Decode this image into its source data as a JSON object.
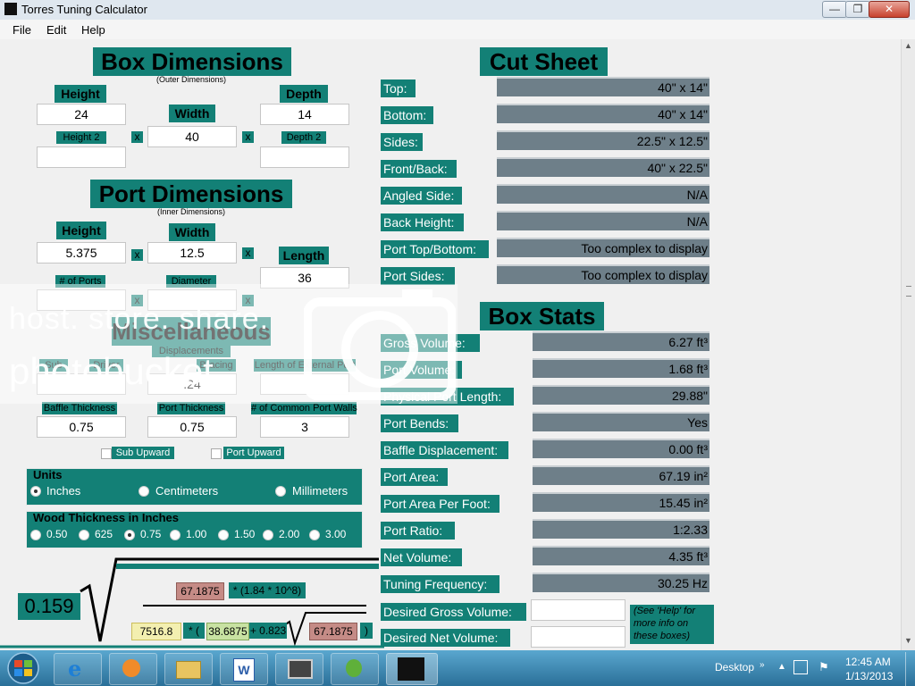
{
  "window": {
    "title": "Torres Tuning Calculator",
    "min": "—",
    "max": "❐",
    "close": "✕"
  },
  "menu": [
    "File",
    "Edit",
    "Help"
  ],
  "box_dimensions": {
    "title": "Box Dimensions",
    "subtitle": "(Outer Dimensions)",
    "height_label": "Height",
    "width_label": "Width",
    "depth_label": "Depth",
    "height": "24",
    "width": "40",
    "depth": "14",
    "height2_label": "Height 2",
    "depth2_label": "Depth 2",
    "height2": "",
    "depth2": ""
  },
  "port_dimensions": {
    "title": "Port Dimensions",
    "subtitle": "(Inner Dimensions)",
    "height_label": "Height",
    "width_label": "Width",
    "length_label": "Length",
    "height": "5.375",
    "width": "12.5",
    "length": "36",
    "ports_label": "# of Ports",
    "diameter_label": "Diameter",
    "ports": "",
    "diameter": ""
  },
  "misc": {
    "title": "Miscellaneous",
    "displacements_label": "Displacements",
    "sub_label": "Sub",
    "driver_label": "Driver",
    "bracing_label": "Bracing",
    "external_port_label": "Length of External Port",
    "sub": "",
    "driver": ".24",
    "bracing": "",
    "external_port": "",
    "baffle_label": "Baffle Thickness",
    "port_thickness_label": "Port Thickness",
    "common_walls_label": "# of Common Port Walls",
    "baffle": "0.75",
    "port_thickness": "0.75",
    "common_walls": "3",
    "sub_upward": "Sub Upward",
    "port_upward": "Port Upward"
  },
  "units": {
    "title": "Units",
    "options": [
      "Inches",
      "Centimeters",
      "Millimeters"
    ],
    "selected": "Inches"
  },
  "wood": {
    "title": "Wood Thickness in Inches",
    "options": [
      "0.50",
      "625",
      "0.75",
      "1.00",
      "1.50",
      "2.00",
      "3.00"
    ],
    "selected": "0.75"
  },
  "x_sign": "x",
  "formula": {
    "coef": "0.159",
    "area1": "67.1875",
    "factor": "* (1.84 * 10^8)",
    "v1": "7516.8",
    "op1": "* (",
    "v2": "38.6875",
    "op2": "+ 0.823",
    "area2": "67.1875",
    "close": ")"
  },
  "cut_sheet": {
    "title": "Cut Sheet",
    "rows": [
      {
        "label": "Top:",
        "value": "40\" x 14\""
      },
      {
        "label": "Bottom:",
        "value": "40\" x 14\""
      },
      {
        "label": "Sides:",
        "value": "22.5\" x 12.5\""
      },
      {
        "label": "Front/Back:",
        "value": "40\" x 22.5\""
      },
      {
        "label": "Angled Side:",
        "value": "N/A"
      },
      {
        "label": "Back Height:",
        "value": "N/A"
      },
      {
        "label": "Port Top/Bottom:",
        "value": "Too complex to display"
      },
      {
        "label": "Port Sides:",
        "value": "Too complex to display"
      }
    ]
  },
  "box_stats": {
    "title": "Box Stats",
    "rows": [
      {
        "label": "Gross Volume:",
        "value": "6.27 ft³"
      },
      {
        "label": "Port Volume:",
        "value": "1.68 ft³"
      },
      {
        "label": "Physical Port Length:",
        "value": "29.88\""
      },
      {
        "label": "Port Bends:",
        "value": "Yes"
      },
      {
        "label": "Baffle Displacement:",
        "value": "0.00 ft³"
      },
      {
        "label": "Port Area:",
        "value": "67.19 in²"
      },
      {
        "label": "Port Area Per Foot:",
        "value": "15.45 in²"
      },
      {
        "label": "Port Ratio:",
        "value": "1:2.33"
      },
      {
        "label": "Net Volume:",
        "value": "4.35 ft³"
      },
      {
        "label": "Tuning Frequency:",
        "value": "30.25 Hz"
      }
    ],
    "desired_gross_label": "Desired Gross Volume:",
    "desired_net_label": "Desired Net Volume:",
    "desired_gross": "",
    "desired_net": "",
    "help_note": "(See 'Help' for more info on these boxes)"
  },
  "taskbar": {
    "desktop": "Desktop",
    "time": "12:45 AM",
    "date": "1/13/2013"
  },
  "watermark": {
    "line1": "host. store. share.",
    "line2": "photobucket"
  }
}
